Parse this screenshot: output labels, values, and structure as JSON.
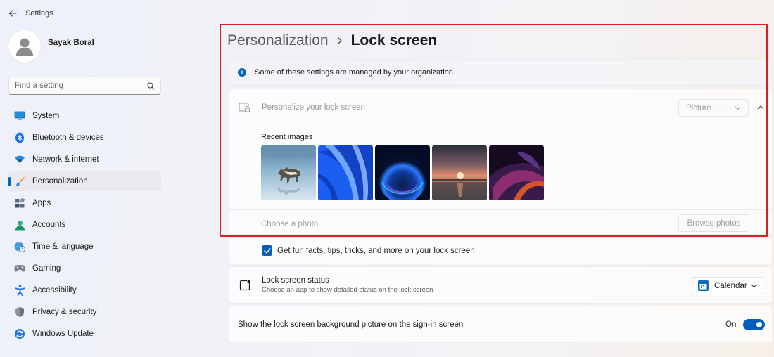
{
  "window": {
    "title": "Settings"
  },
  "user": {
    "name": "Sayak Boral"
  },
  "search": {
    "placeholder": "Find a setting"
  },
  "sidebar": {
    "items": [
      {
        "label": "System",
        "icon": "monitor-icon",
        "active": false
      },
      {
        "label": "Bluetooth & devices",
        "icon": "bluetooth-icon",
        "active": false
      },
      {
        "label": "Network & internet",
        "icon": "wifi-icon",
        "active": false
      },
      {
        "label": "Personalization",
        "icon": "paintbrush-icon",
        "active": true
      },
      {
        "label": "Apps",
        "icon": "apps-icon",
        "active": false
      },
      {
        "label": "Accounts",
        "icon": "person-icon",
        "active": false
      },
      {
        "label": "Time & language",
        "icon": "globe-clock-icon",
        "active": false
      },
      {
        "label": "Gaming",
        "icon": "gamepad-icon",
        "active": false
      },
      {
        "label": "Accessibility",
        "icon": "accessibility-icon",
        "active": false
      },
      {
        "label": "Privacy & security",
        "icon": "shield-icon",
        "active": false
      },
      {
        "label": "Windows Update",
        "icon": "update-icon",
        "active": false
      }
    ]
  },
  "breadcrumb": {
    "parent": "Personalization",
    "current": "Lock screen"
  },
  "info": {
    "text": "Some of these settings are managed by your organization."
  },
  "lock_screen": {
    "label": "Personalize your lock screen",
    "mode_value": "Picture",
    "recent_label": "Recent images",
    "recent_images": [
      "wolf-on-ice",
      "blue-ribbons",
      "blue-bloom",
      "sunset-lake",
      "purple-swirl"
    ],
    "choose_label": "Choose a photo",
    "browse_label": "Browse photos"
  },
  "fun_facts": {
    "label": "Get fun facts, tips, tricks, and more on your lock screen",
    "checked": true
  },
  "status": {
    "title": "Lock screen status",
    "description": "Choose an app to show detailed status on the lock screen",
    "value": "Calendar"
  },
  "signin": {
    "label": "Show the lock screen background picture on the sign-in screen",
    "state_label": "On",
    "enabled": true
  },
  "colors": {
    "accent": "#005fb8",
    "highlight_frame": "#d81f26"
  }
}
